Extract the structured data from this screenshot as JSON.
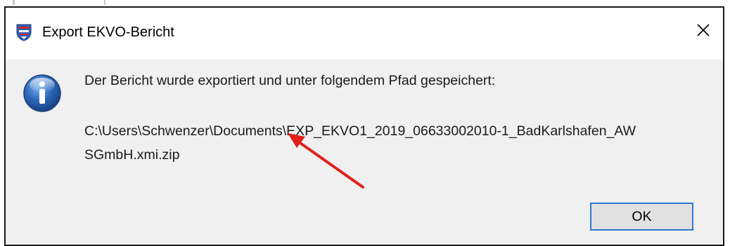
{
  "dialog": {
    "title": "Export EKVO-Bericht",
    "message": "Der Bericht wurde exportiert und unter folgendem Pfad gespeichert:",
    "path_line1": "C:\\Users\\Schwenzer\\Documents\\EXP_EKVO1_2019_06633002010-1_BadKarlshafen_AW",
    "path_line2": "SGmbH.xmi.zip",
    "ok_label": "OK",
    "close_symbol": "✕"
  },
  "icons": {
    "app": "hesse-coat-of-arms-icon",
    "info": "info-icon",
    "close": "close-icon"
  },
  "annotation": {
    "type": "arrow",
    "color": "#e0201b"
  },
  "colors": {
    "dialog_background": "#f0f0f0",
    "titlebar_background": "#ffffff",
    "ok_button_border": "#2f7bd1",
    "info_icon_blue": "#2a66b8"
  }
}
